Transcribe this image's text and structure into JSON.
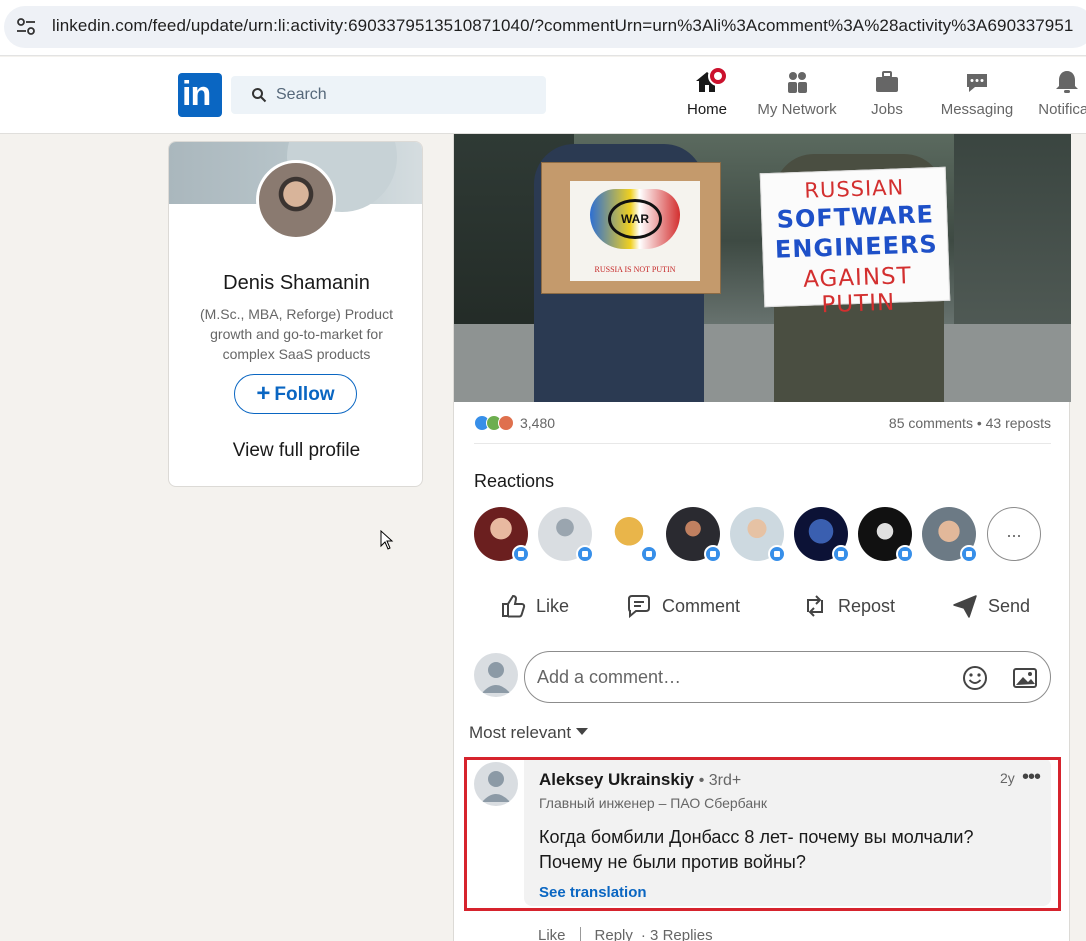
{
  "browser": {
    "url": "linkedin.com/feed/update/urn:li:activity:6903379513510871040/?commentUrn=urn%3Ali%3Acomment%3A%28activity%3A690337951"
  },
  "nav": {
    "search_placeholder": "Search",
    "items": [
      {
        "label": "Home",
        "icon": "home-icon"
      },
      {
        "label": "My Network",
        "icon": "network-icon"
      },
      {
        "label": "Jobs",
        "icon": "briefcase-icon"
      },
      {
        "label": "Messaging",
        "icon": "chat-icon"
      },
      {
        "label": "Notificati",
        "icon": "bell-icon"
      }
    ]
  },
  "profile": {
    "name": "Denis Shamanin",
    "headline": "(M.Sc., MBA, Reforge) Product growth and go-to-market for complex SaaS products",
    "follow_label": "Follow",
    "view_label": "View full profile"
  },
  "post": {
    "photo": {
      "sign_left_war": "WAR",
      "sign_left_caption": "RUSSIA IS NOT PUTIN",
      "sign_right_lines": [
        "RUSSIAN",
        "SOFTWARE",
        "ENGINEERS",
        "AGAINST PUTIN"
      ]
    },
    "reaction_count": "3,480",
    "comments_reposts": "85 comments • 43 reposts",
    "reactions_title": "Reactions",
    "more_reactions": "...",
    "actions": {
      "like": "Like",
      "comment": "Comment",
      "repost": "Repost",
      "send": "Send"
    },
    "comment_placeholder": "Add a comment…",
    "sort_label": "Most relevant"
  },
  "comment": {
    "author": "Aleksey Ukrainskiy",
    "degree": "• 3rd+",
    "job": "Главный инженер – ПАО Сбербанк",
    "time": "2y",
    "more": "•••",
    "text": "Когда бомбили Донбасс 8 лет- почему вы молчали? Почему не были против войны?",
    "see_translation": "See translation",
    "footer": {
      "like": "Like",
      "reply": "Reply",
      "replies": "· 3 Replies"
    }
  },
  "colors": {
    "brand": "#0a66c2",
    "highlight_box": "#d6232d",
    "notification_badge": "#cb112d"
  }
}
